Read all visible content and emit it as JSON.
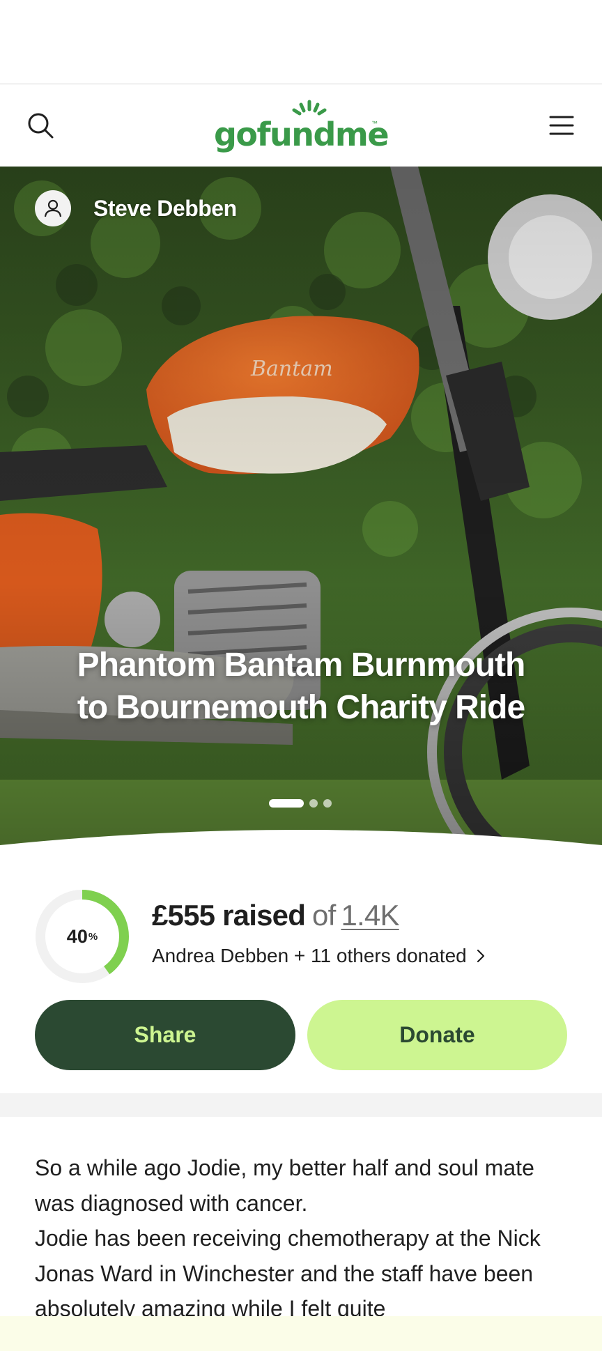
{
  "header": {
    "logo_text": "gofundme",
    "logo_tm": "™",
    "brand_color": "#3a9a49",
    "search_icon": "search-icon",
    "menu_icon": "hamburger-menu-icon"
  },
  "hero": {
    "organizer_name": "Steve Debben",
    "title": "Phantom Bantam Burnmouth to Bournemouth Charity Ride",
    "slides": {
      "count": 3,
      "active_index": 0
    }
  },
  "progress": {
    "percent_label": "40",
    "percent_sign": "%",
    "percent_value": 0.4,
    "raised_amount": "£555 raised",
    "of_label": "of",
    "goal": "1.4K",
    "donors_text": "Andrea Debben + 11 others donated",
    "ring_color": "#7fd04f"
  },
  "actions": {
    "share_label": "Share",
    "donate_label": "Donate",
    "share_bg": "#2b4932",
    "donate_bg": "#cdf591"
  },
  "story": {
    "paragraphs": [
      "So a while ago Jodie, my better half and soul mate was diagnosed with cancer.",
      "Jodie has been receiving chemotherapy at the Nick Jonas Ward in Winchester and the staff have been absolutely amazing while I felt quite"
    ]
  }
}
